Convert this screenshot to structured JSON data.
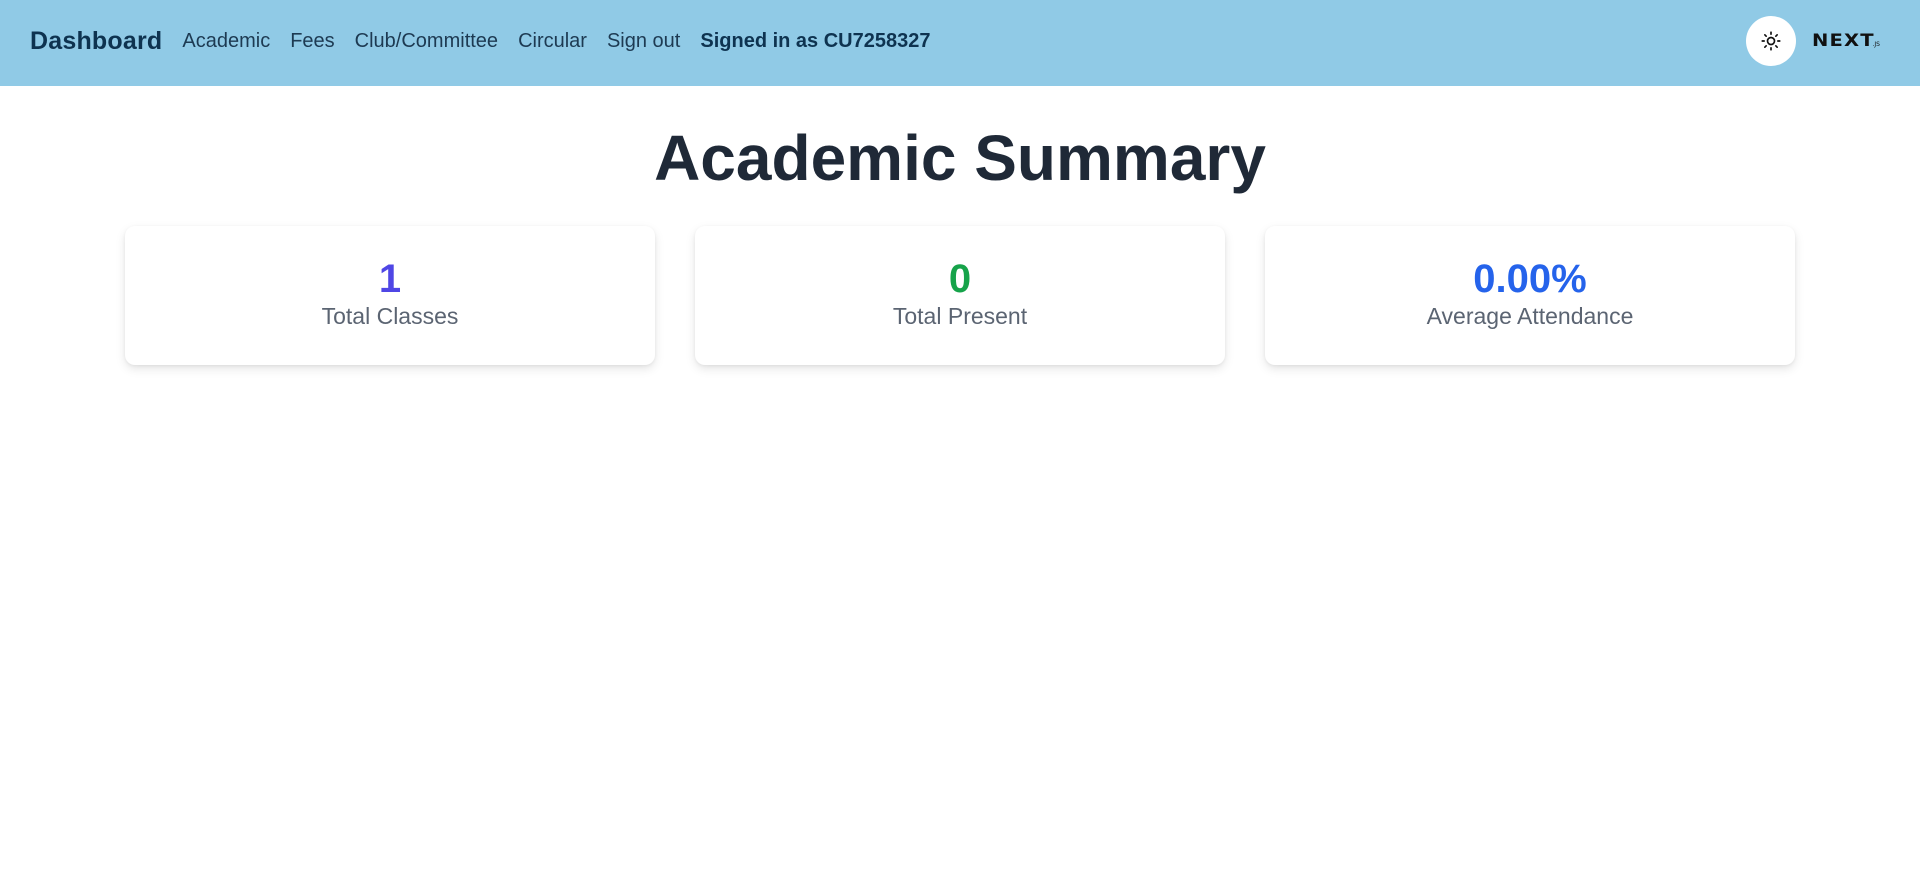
{
  "navbar": {
    "brand": "Dashboard",
    "links": [
      "Academic",
      "Fees",
      "Club/Committee",
      "Circular",
      "Sign out"
    ],
    "signed_in_text": "Signed in as CU7258327",
    "theme_toggle_icon": "sun-icon",
    "logo": {
      "main": "NEXT",
      "suffix": ".JS"
    },
    "background_color": "#90cae6"
  },
  "main": {
    "title": "Academic Summary",
    "stats": [
      {
        "value": "1",
        "label": "Total Classes",
        "color": "#4f46e5"
      },
      {
        "value": "0",
        "label": "Total Present",
        "color": "#16a34a"
      },
      {
        "value": "0.00%",
        "label": "Average Attendance",
        "color": "#2563eb"
      }
    ]
  }
}
